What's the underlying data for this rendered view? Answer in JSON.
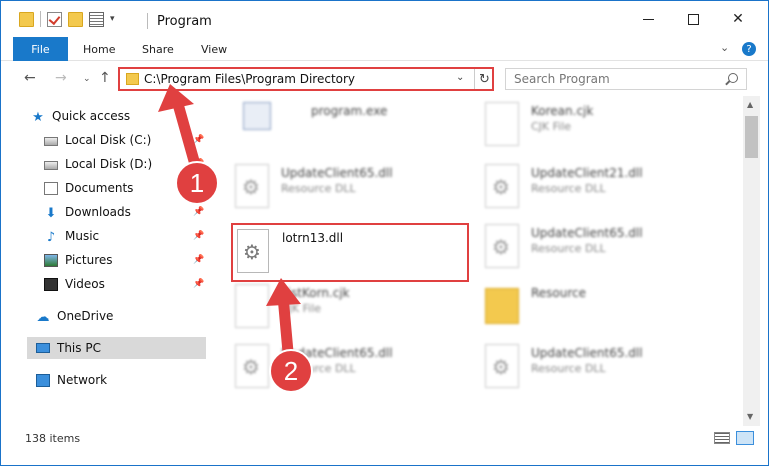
{
  "window": {
    "title": "Program"
  },
  "ribbon": {
    "file": "File",
    "home": "Home",
    "share": "Share",
    "view": "View",
    "collapse": "⌄",
    "help": "?"
  },
  "address": {
    "path": "C:\\Program Files\\Program Directory",
    "search_placeholder": "Search Program"
  },
  "nav_pane": {
    "items": [
      {
        "label": "Quick access",
        "icon": "star-icon"
      },
      {
        "label": "Local Disk (C:)",
        "icon": "disk-icon",
        "pinned": true
      },
      {
        "label": "Local Disk (D:)",
        "icon": "disk-icon",
        "pinned": true
      },
      {
        "label": "Documents",
        "icon": "documents-icon",
        "pinned": true
      },
      {
        "label": "Downloads",
        "icon": "download-icon",
        "pinned": true
      },
      {
        "label": "Music",
        "icon": "music-icon",
        "pinned": true
      },
      {
        "label": "Pictures",
        "icon": "pictures-icon",
        "pinned": true
      },
      {
        "label": "Videos",
        "icon": "videos-icon",
        "pinned": true
      },
      {
        "label": "OneDrive",
        "icon": "cloud-icon"
      },
      {
        "label": "This PC",
        "icon": "computer-icon",
        "selected": true
      },
      {
        "label": "Network",
        "icon": "network-icon"
      }
    ]
  },
  "files": [
    {
      "name": "program.exe",
      "type": ""
    },
    {
      "name": "Korean.cjk",
      "type": "CJK File"
    },
    {
      "name": "UpdateClient65.dll",
      "type": "Resource DLL"
    },
    {
      "name": "UpdateClient21.dll",
      "type": "Resource DLL"
    },
    {
      "name": "lotrn13.dll",
      "type": ""
    },
    {
      "name": "UpdateClient65.dll",
      "type": "Resource DLL"
    },
    {
      "name": "ListKorn.cjk",
      "type": "CJK File"
    },
    {
      "name": "Resource",
      "type": ""
    },
    {
      "name": "UpdateClient65.dll",
      "type": "Resource DLL"
    },
    {
      "name": "UpdateClient65.dll",
      "type": "Resource DLL"
    }
  ],
  "status": {
    "count": "138 items"
  },
  "annotations": {
    "step1": "1",
    "step2": "2",
    "color": "#e04040"
  }
}
